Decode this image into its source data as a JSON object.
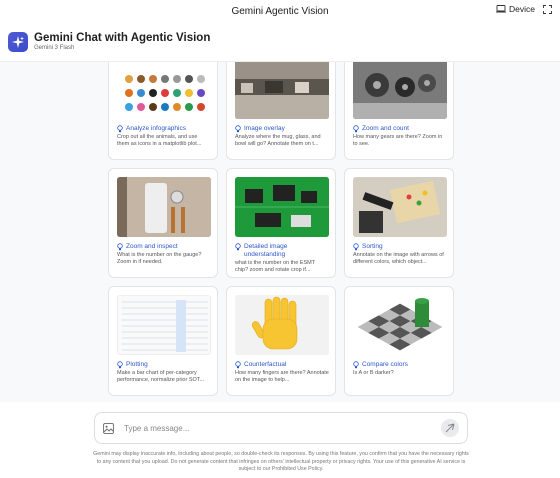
{
  "window": {
    "title": "Gemini Agentic Vision",
    "device_label": "Device"
  },
  "header": {
    "title": "Gemini Chat with Agentic Vision",
    "subtitle": "Gemini 3 Flash"
  },
  "cards": [
    {
      "title": "Analyze infographics",
      "desc": "Crop out all the animals, and use them as icons in a matplotlib plot...",
      "thumb": "animal-icons-infographic"
    },
    {
      "title": "Image overlay",
      "desc": "Analyze where the mug, glass, and bowl will go? Annotate them on t...",
      "thumb": "kitchen-counter-photo"
    },
    {
      "title": "Zoom and count",
      "desc": "How many gears are there? Zoom in to see.",
      "thumb": "gear-mechanism-photo"
    },
    {
      "title": "Zoom and inspect",
      "desc": "What is the number on the gauge? Zoom in if needed.",
      "thumb": "water-heater-gauge-photo"
    },
    {
      "title": "Detailed image understanding",
      "desc": "what is the number on the ESMT chip? zoom and rotate crop if...",
      "thumb": "green-circuit-board-photo"
    },
    {
      "title": "Sorting",
      "desc": "Annotate on the image with arrows of different colors, which object...",
      "thumb": "robot-arm-sorting-photo"
    },
    {
      "title": "Plotting",
      "desc": "Make a bar chart of per-category performance, normalize prior SOT...",
      "thumb": "results-table-screenshot"
    },
    {
      "title": "Counterfactual",
      "desc": "How many fingers are there? Annotate on the image to help...",
      "thumb": "raised-hand-emoji"
    },
    {
      "title": "Compare colors",
      "desc": "Is A or B darker?",
      "thumb": "checker-shadow-illusion"
    }
  ],
  "composer": {
    "placeholder": "Type a message..."
  },
  "disclaimer": "Gemini may display inaccurate info, including about people, so double-check its responses. By using this feature, you confirm that you have the necessary rights to any content that you upload. Do not generate content that infringes on others' intellectual property or privacy rights. Your use of this generative AI service is subject to our Prohibited Use Policy.",
  "colors": {
    "accent": "#2b57c9",
    "logo": "#4f5bd5",
    "background": "#f8f9fa"
  }
}
